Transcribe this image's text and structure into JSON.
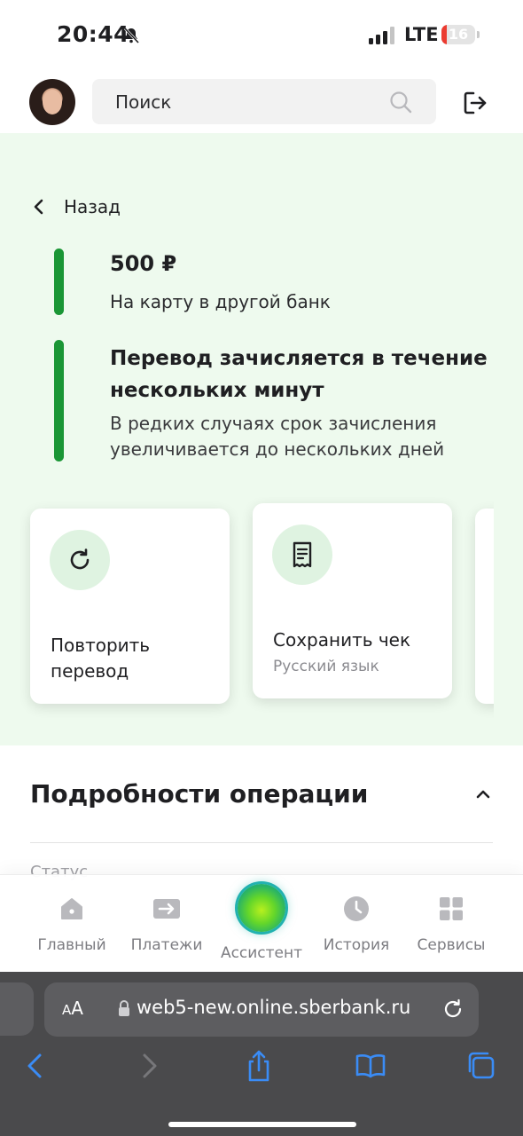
{
  "status_bar": {
    "time": "20:44",
    "network": "LTE",
    "battery_level": "16",
    "battery_fraction": 0.16,
    "icons": [
      "bell-muted-icon",
      "signal-bars-icon",
      "battery-icon"
    ]
  },
  "header": {
    "search_placeholder": "Поиск",
    "icons": [
      "avatar",
      "search-icon",
      "logout-icon"
    ]
  },
  "transfer": {
    "back_label": "Назад",
    "amount": "500 ₽",
    "amount_description": "На карту в другой банк",
    "info_title": "Перевод зачисляется в течение нескольких минут",
    "info_description": "В редких случаях срок зачисления увеличивается до нескольких дней",
    "accent_color": "#1a9635",
    "background_color": "#eefaee"
  },
  "actions": [
    {
      "title": "Повторить перевод",
      "subtitle": "",
      "icon": "repeat-icon"
    },
    {
      "title": "Сохранить чек",
      "subtitle": "Русский язык",
      "icon": "receipt-icon"
    }
  ],
  "details": {
    "title": "Подробности операции",
    "peek_text": "Статус"
  },
  "bottom_nav": {
    "items": [
      {
        "label": "Главный",
        "icon": "home-icon"
      },
      {
        "label": "Платежи",
        "icon": "payments-icon"
      },
      {
        "label": "Ассистент",
        "icon": "assistant-orb-icon"
      },
      {
        "label": "История",
        "icon": "clock-icon"
      },
      {
        "label": "Сервисы",
        "icon": "grid-icon"
      }
    ]
  },
  "browser": {
    "text_size_label_small": "A",
    "text_size_label_large": "A",
    "url": "web5-new.online.sberbank.ru",
    "accent_color": "#3a8cf6",
    "icons": [
      "lock-icon",
      "reload-icon",
      "back-arrow-icon",
      "forward-arrow-icon",
      "share-icon",
      "bookmarks-icon",
      "tabs-icon"
    ]
  }
}
